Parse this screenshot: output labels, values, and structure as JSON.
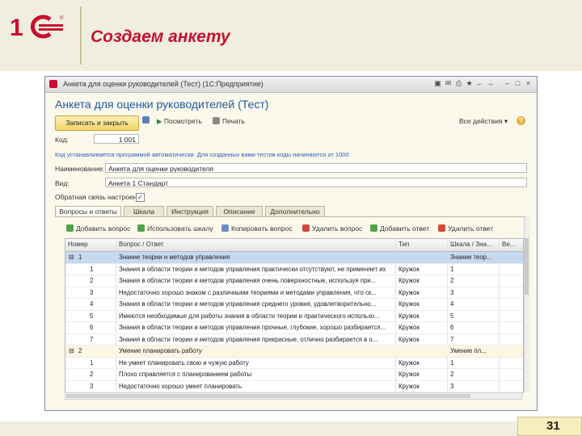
{
  "slide": {
    "title": "Создаем анкету",
    "page_number": "31"
  },
  "window": {
    "title": "Анкета для оценки руководителей (Тест) (1С:Предприятие)",
    "title_buttons": [
      "▣",
      "✉",
      "⎙",
      "★",
      "←",
      "→",
      "–",
      "□",
      "×"
    ]
  },
  "form": {
    "title": "Анкета для оценки руководителей (Тест)",
    "commands": {
      "save_close": "Записать и закрыть",
      "save_icon": "save-icon",
      "preview": "Посмотреть",
      "print": "Печать",
      "all_actions": "Все действия ▾",
      "help": "?"
    },
    "code_label": "Код:",
    "code_value": "1 001",
    "info_text": "Код устанавливается программой автоматически. Для созданных вами тестов коды начинаются от 1000",
    "name_label": "Наименование:",
    "name_value": "Анкета для оценки руководителя",
    "type_label": "Вид:",
    "type_value": "Анкета 1 Стандарт",
    "feedback_label": "Обратная связь настроена:",
    "feedback_checked": "✓",
    "tabs": [
      "Вопросы и ответы",
      "Шкала",
      "Инструкция",
      "Описание",
      "Дополнительно"
    ],
    "table_commands": [
      "Добавить вопрос",
      "Использовать шкалу",
      "Копировать вопрос",
      "Удалить вопрос",
      "Добавить ответ",
      "Удалить ответ"
    ],
    "grid_headers": [
      "Номер",
      "Вопрос / Ответ",
      "Тип",
      "Шкала / Зна...",
      "Ве..."
    ],
    "grid_rows": [
      {
        "num": "1",
        "text": "Знание теории и методов управления",
        "type": "",
        "value": "Знание теор...",
        "kind": "sel"
      },
      {
        "num": "1",
        "text": "Знания в области теории и методов управления практически отсутствуют, не применяет их",
        "type": "Кружок",
        "value": "1",
        "kind": "row"
      },
      {
        "num": "2",
        "text": "Знания в области теории и методов управления очень поверхностные, используя при...",
        "type": "Кружок",
        "value": "2",
        "kind": "row"
      },
      {
        "num": "3",
        "text": "Недостаточно хорошо знаком с различными теориями и методами управления, что ск...",
        "type": "Кружок",
        "value": "3",
        "kind": "row"
      },
      {
        "num": "4",
        "text": "Знания в области теории и методов управления среднего уровня, удовлетворительно...",
        "type": "Кружок",
        "value": "4",
        "kind": "row"
      },
      {
        "num": "5",
        "text": "Имеются необходимые для работы знания в области теории и практического использо...",
        "type": "Кружок",
        "value": "5",
        "kind": "row"
      },
      {
        "num": "6",
        "text": "Знания в области теории и методов управления прочные, глубокие, хорошо разбирается...",
        "type": "Кружок",
        "value": "6",
        "kind": "row"
      },
      {
        "num": "7",
        "text": "Знания в области теории и методов управления прекрасные, отлично разбирается в о...",
        "type": "Кружок",
        "value": "7",
        "kind": "row"
      },
      {
        "num": "2",
        "text": "Умение планировать работу",
        "type": "",
        "value": "Умение пл...",
        "kind": "group"
      },
      {
        "num": "1",
        "text": "Не умеет планировать свою и чужую работу",
        "type": "Кружок",
        "value": "1",
        "kind": "row"
      },
      {
        "num": "2",
        "text": "Плохо справляется с планированием работы",
        "type": "Кружок",
        "value": "2",
        "kind": "row"
      },
      {
        "num": "3",
        "text": "Недостаточно хорошо умеет планировать",
        "type": "Кружок",
        "value": "3",
        "kind": "row"
      }
    ]
  },
  "colors": {
    "brand_red": "#c8102e",
    "link_blue": "#2a5cb8",
    "selection": "#c7d9ef"
  }
}
